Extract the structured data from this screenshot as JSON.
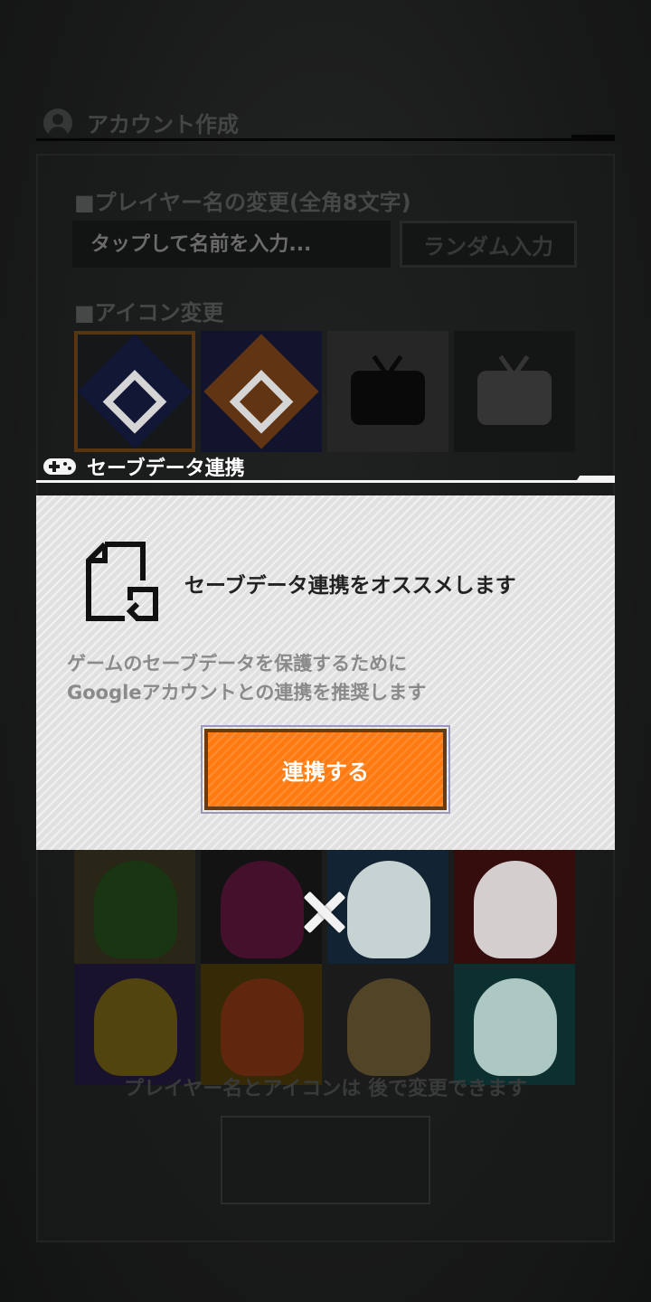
{
  "background": {
    "header_title": "アカウント作成",
    "name_section_label": "■プレイヤー名の変更(全角8文字)",
    "name_input_placeholder": "タップして名前を入力...",
    "random_button_label": "ランダム入力",
    "icon_section_label": "■アイコン変更",
    "hint_text": "プレイヤー名とアイコンは 後で変更できます",
    "icons": [
      {
        "kind": "diamond",
        "bg": "#181a1c",
        "fg": "#131a3a",
        "selected": true
      },
      {
        "kind": "diamond",
        "bg": "#141631",
        "fg": "#6a3a16",
        "selected": false
      },
      {
        "kind": "tv",
        "bg": "#2a2a2a",
        "fg": "#0a0a0a",
        "selected": false
      },
      {
        "kind": "tv",
        "bg": "#161717",
        "fg": "#3a3a3a",
        "selected": false
      },
      {
        "kind": "face",
        "bg": "#2e2a1a",
        "fg": "#1c3a14",
        "selected": false
      },
      {
        "kind": "face",
        "bg": "#151515",
        "fg": "#4a1230",
        "selected": false
      },
      {
        "kind": "face",
        "bg": "#142838",
        "fg": "#d8e4e4",
        "selected": false
      },
      {
        "kind": "face",
        "bg": "#3a0f0f",
        "fg": "#e8e0e0",
        "selected": false
      },
      {
        "kind": "face",
        "bg": "#1b1430",
        "fg": "#5a4a10",
        "selected": false
      },
      {
        "kind": "face",
        "bg": "#3a2e06",
        "fg": "#6a2a10",
        "selected": false
      },
      {
        "kind": "face",
        "bg": "#1e1e1e",
        "fg": "#5a4a2a",
        "selected": false
      },
      {
        "kind": "face",
        "bg": "#0e3433",
        "fg": "#bcd8d4",
        "selected": false
      }
    ]
  },
  "modal": {
    "title": "セーブデータ連携",
    "headline": "セーブデータ連携をオススメします",
    "description_line1": "ゲームのセーブデータを保護するために",
    "description_line2": "Googleアカウントとの連携を推奨します",
    "link_button_label": "連携する",
    "accent_color": "#ff7a10"
  }
}
